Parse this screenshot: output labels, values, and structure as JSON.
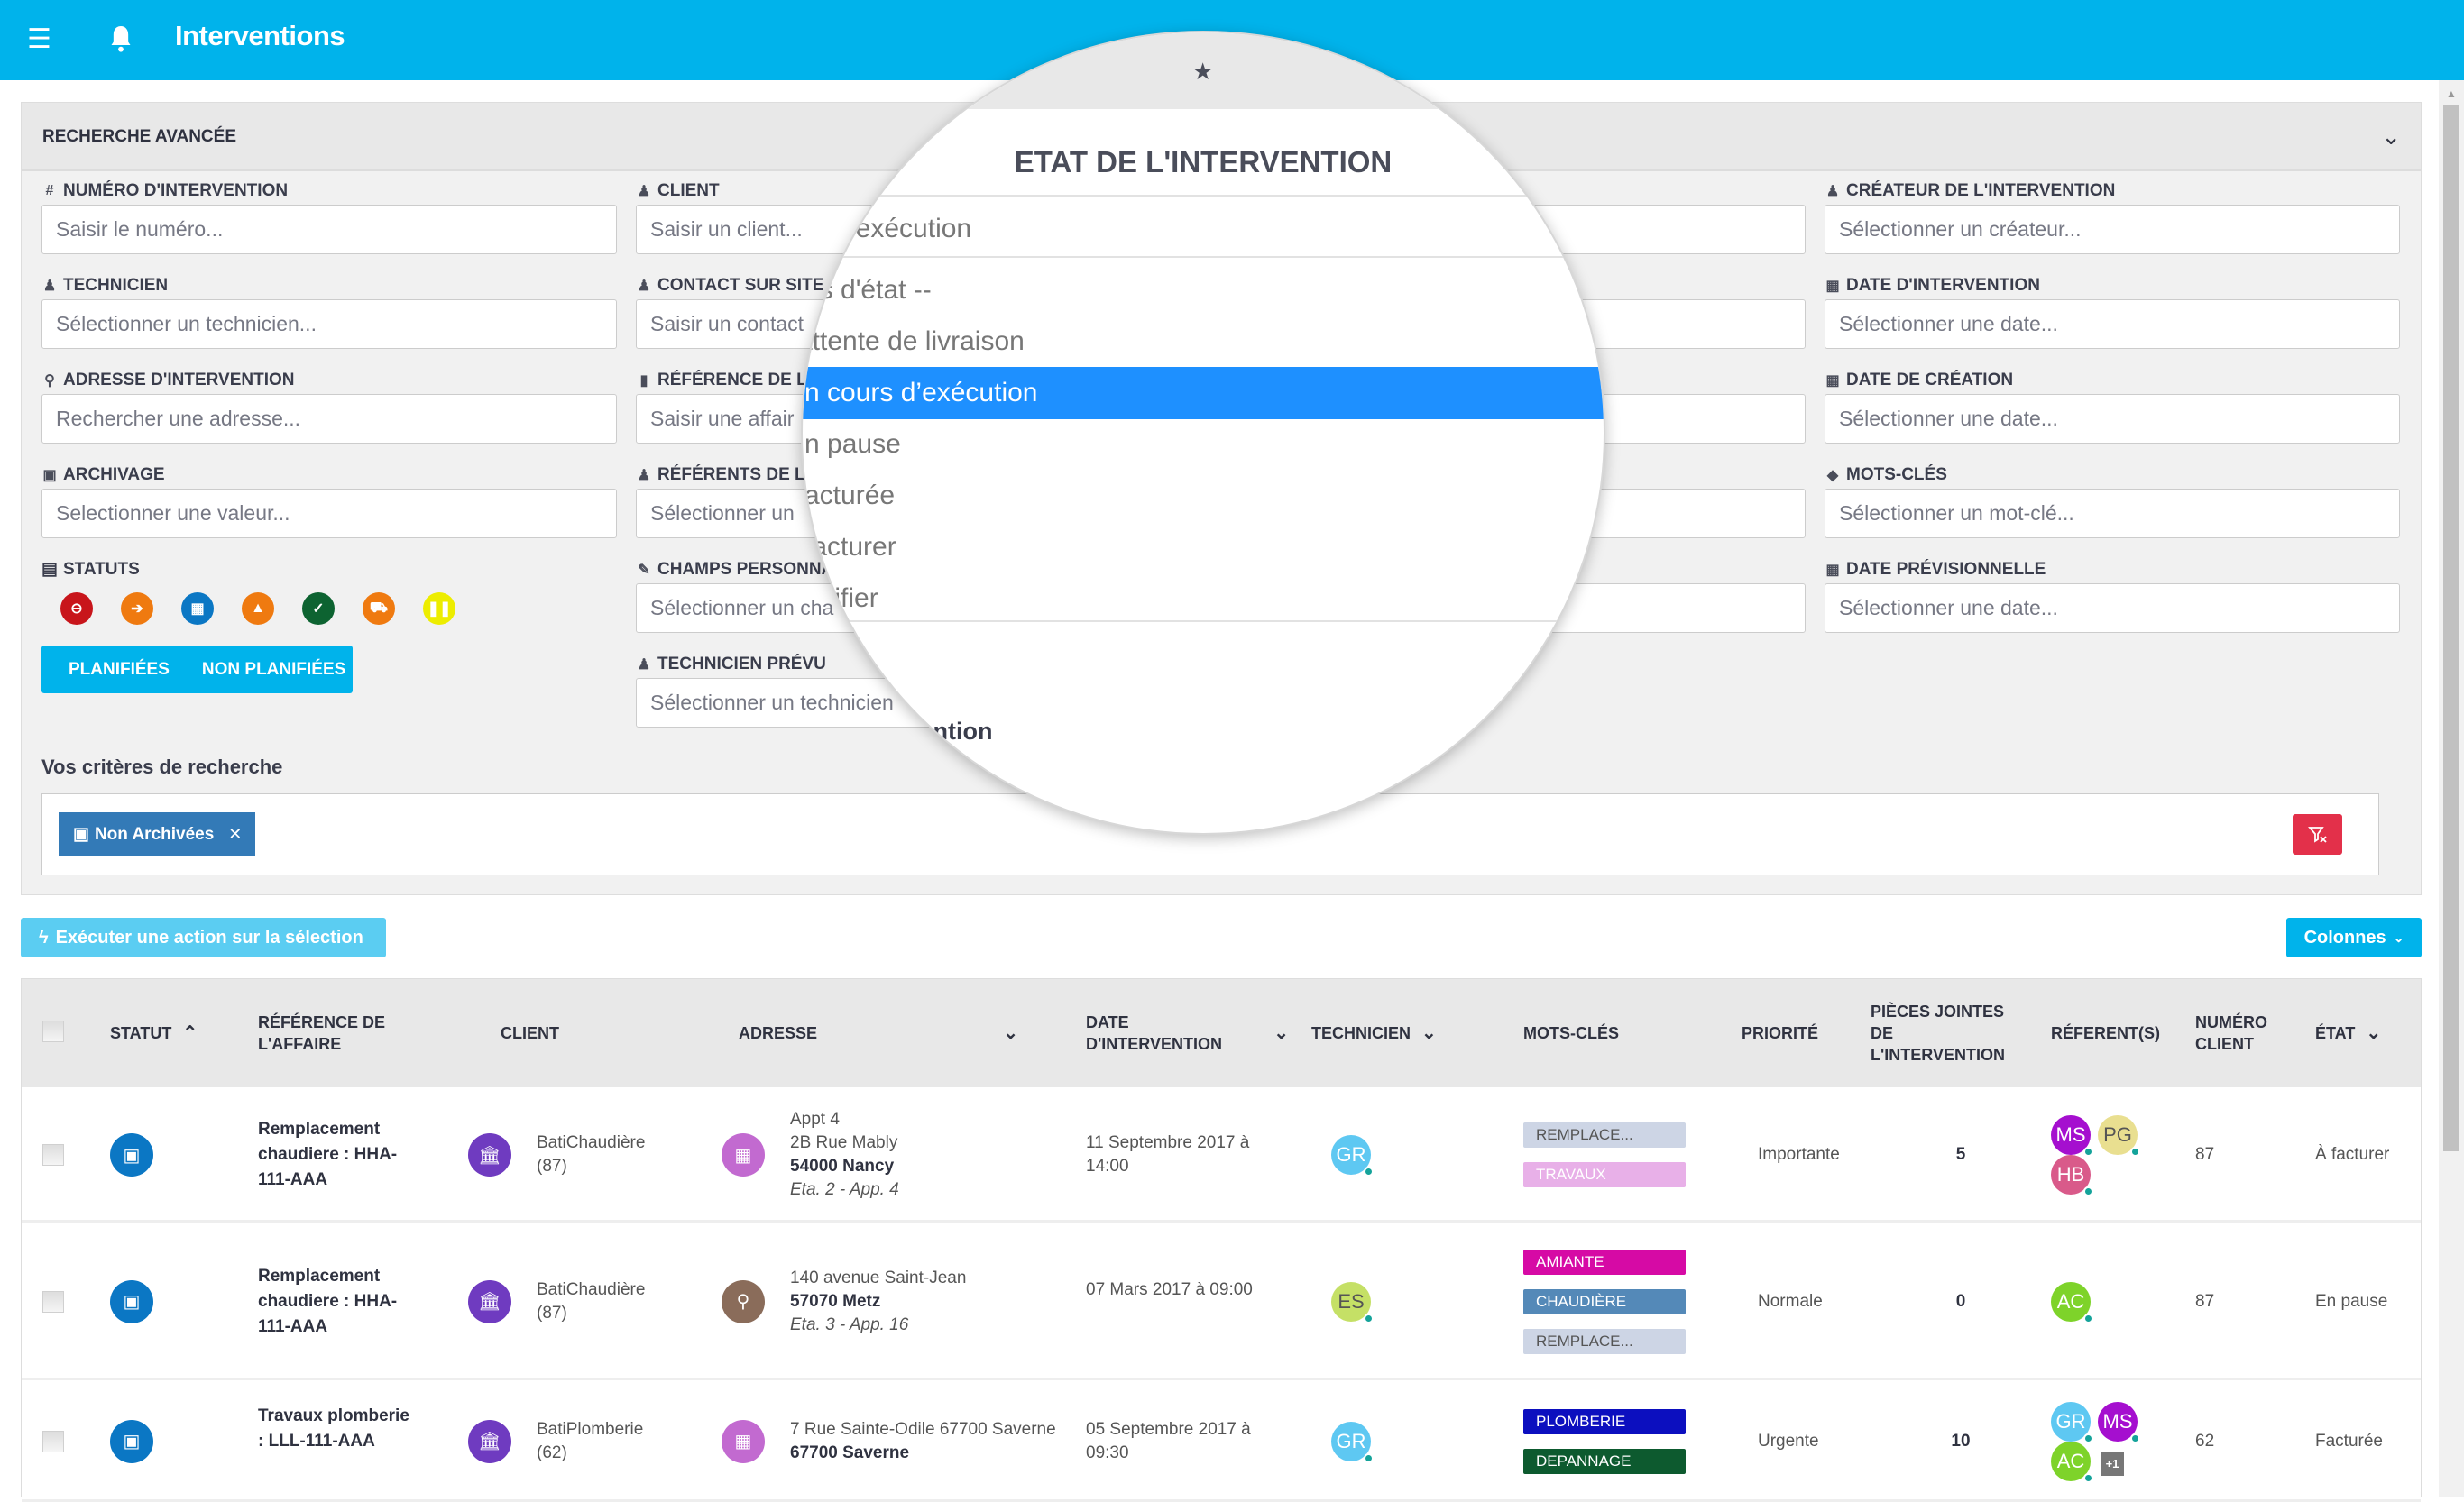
{
  "header": {
    "title": "Interventions",
    "menu_icon": "hamburger-icon",
    "bell_icon": "bell-icon"
  },
  "search_panel": {
    "title": "RECHERCHE AVANCÉE",
    "fields": [
      {
        "label": "NUMÉRO D'INTERVENTION",
        "icon": "#",
        "placeholder": "Saisir le numéro..."
      },
      {
        "label": "TECHNICIEN",
        "icon": "♟",
        "placeholder": "Sélectionner un technicien..."
      },
      {
        "label": "ADRESSE D'INTERVENTION",
        "icon": "⚲",
        "placeholder": "Rechercher une adresse..."
      },
      {
        "label": "ARCHIVAGE",
        "icon": "▣",
        "placeholder": "Selectionner une valeur..."
      },
      {
        "label": "CLIENT",
        "icon": "♟",
        "placeholder": "Saisir un client..."
      },
      {
        "label": "CONTACT SUR SITE",
        "icon": "♟",
        "placeholder": "Saisir un contact"
      },
      {
        "label": "RÉFÉRENCE DE L'A",
        "icon": "▮",
        "placeholder": "Saisir une affair"
      },
      {
        "label": "RÉFÉRENTS DE L'I",
        "icon": "♟",
        "placeholder": "Sélectionner un"
      },
      {
        "label": "CHAMPS PERSONNA",
        "icon": "✎",
        "placeholder": "Sélectionner un cha"
      },
      {
        "label": "TECHNICIEN PRÉVU",
        "icon": "♟",
        "placeholder": "Sélectionner un technicien"
      },
      {
        "label": "CRÉATEUR DE L'INTERVENTION",
        "icon": "♟",
        "placeholder": "Sélectionner un créateur..."
      },
      {
        "label": "DATE D'INTERVENTION",
        "icon": "▦",
        "placeholder": "Sélectionner une date..."
      },
      {
        "label": "DATE DE CRÉATION",
        "icon": "▦",
        "placeholder": "Sélectionner une date..."
      },
      {
        "label": "MOTS-CLÉS",
        "icon": "◆",
        "placeholder": "Sélectionner un mot-clé..."
      },
      {
        "label": "DATE PRÉVISIONNELLE",
        "icon": "▦",
        "placeholder": "Sélectionner une date..."
      }
    ],
    "statuts": {
      "label": "STATUTS",
      "icons": [
        {
          "name": "cancelled-status-icon",
          "glyph": "⊖",
          "color": "#c8151b"
        },
        {
          "name": "arrow-status-icon",
          "glyph": "➔",
          "color": "#ef7a10"
        },
        {
          "name": "scheduled-status-icon",
          "glyph": "▦",
          "color": "#0b77c4"
        },
        {
          "name": "warning-status-icon",
          "glyph": "▲",
          "color": "#ef7a10"
        },
        {
          "name": "done-status-icon",
          "glyph": "✓",
          "color": "#0d6331"
        },
        {
          "name": "car-status-icon",
          "glyph": "⛟",
          "color": "#ef7a10"
        },
        {
          "name": "pause-status-icon",
          "glyph": "❚❚",
          "color": "#eded00"
        }
      ]
    },
    "plan_buttons": [
      "PLANIFIÉES",
      "NON PLANIFIÉES"
    ],
    "criteria_title": "Vos critères de recherche",
    "criteria_chip": "Non Archivées",
    "clear_filter_icon": "filter-clear-icon"
  },
  "magnifier": {
    "title": "ETAT DE L'INTERVENTION",
    "input_value": "rs d’exécution",
    "options": [
      "as d'état --",
      " attente de livraison",
      "n cours d’exécution",
      "n pause",
      "acturée",
      "facturer",
      "anifier"
    ],
    "selected_index": 2,
    "bottom_label": "rvention"
  },
  "toolbar": {
    "action_label": "Exécuter une action sur la sélection",
    "columns_label": "Colonnes"
  },
  "table": {
    "columns": [
      "STATUT",
      "RÉFÉRENCE DE L'AFFAIRE",
      "CLIENT",
      "ADRESSE",
      "DATE D'INTERVENTION",
      "TECHNICIEN",
      "MOTS-CLÉS",
      "PRIORITÉ",
      "PIÈCES JOINTES DE L'INTERVENTION",
      "RÉFERENT(S)",
      "NUMÉRO CLIENT",
      "ÉTAT"
    ],
    "rows": [
      {
        "reference": "Remplacement chaudiere : HHA-111-AAA",
        "client": "BatiChaudière",
        "client_num": "(87)",
        "address_lines": [
          "Appt 4",
          "2B Rue Mably"
        ],
        "address_city": "54000 Nancy",
        "address_extra": "Eta. 2 - App. 4",
        "address_icon_color": "#c26ad0",
        "date": "11 Septembre 2017 à 14:00",
        "technician": {
          "initials": "GR",
          "color": "#5ec8f2"
        },
        "tags": [
          {
            "label": "REMPLACE...",
            "bg": "#cdd5e5",
            "fg": "#555"
          },
          {
            "label": "TRAVAUX",
            "bg": "#e8b0e8",
            "fg": "#fff"
          }
        ],
        "priority": "Importante",
        "attachments": "5",
        "referents": [
          {
            "initials": "MS",
            "color": "#a50fcf"
          },
          {
            "initials": "PG",
            "color": "#e9df90",
            "fg": "#555"
          },
          {
            "initials": "HB",
            "color": "#d95a8a"
          }
        ],
        "extra_referents": "",
        "client_number": "87",
        "state": "À facturer"
      },
      {
        "reference": "Remplacement chaudiere : HHA-111-AAA",
        "client": "BatiChaudière",
        "client_num": "(87)",
        "address_lines": [
          "140 avenue Saint-Jean"
        ],
        "address_city": "57070 Metz",
        "address_extra": "Eta. 3 - App. 16",
        "address_icon_color": "#8a6c5a",
        "date": "07 Mars 2017 à 09:00",
        "technician": {
          "initials": "ES",
          "color": "#c5e066",
          "fg": "#555"
        },
        "tags": [
          {
            "label": "AMIANTE",
            "bg": "#d60aa5",
            "fg": "#fff"
          },
          {
            "label": "CHAUDIÈRE",
            "bg": "#5489b8",
            "fg": "#fff"
          },
          {
            "label": "REMPLACE...",
            "bg": "#cdd5e5",
            "fg": "#555"
          }
        ],
        "priority": "Normale",
        "attachments": "0",
        "referents": [
          {
            "initials": "AC",
            "color": "#7ed32a"
          }
        ],
        "extra_referents": "",
        "client_number": "87",
        "state": "En pause"
      },
      {
        "reference": "Travaux plomberie : LLL-111-AAA",
        "client": "BatiPlomberie",
        "client_num": "(62)",
        "address_lines": [
          "7 Rue Sainte-Odile 67700 Saverne"
        ],
        "address_city": "67700 Saverne",
        "address_extra": "",
        "address_icon_color": "#c26ad0",
        "date": "05 Septembre 2017 à 09:30",
        "technician": {
          "initials": "GR",
          "color": "#5ec8f2"
        },
        "tags": [
          {
            "label": "PLOMBERIE",
            "bg": "#0c0fbf",
            "fg": "#fff"
          },
          {
            "label": "DEPANNAGE",
            "bg": "#0d5a2f",
            "fg": "#fff"
          }
        ],
        "priority": "Urgente",
        "attachments": "10",
        "referents": [
          {
            "initials": "GR",
            "color": "#5ec8f2"
          },
          {
            "initials": "MS",
            "color": "#a50fcf"
          },
          {
            "initials": "AC",
            "color": "#7ed32a"
          }
        ],
        "extra_referents": "+1",
        "client_number": "62",
        "state": "Facturée"
      }
    ]
  }
}
